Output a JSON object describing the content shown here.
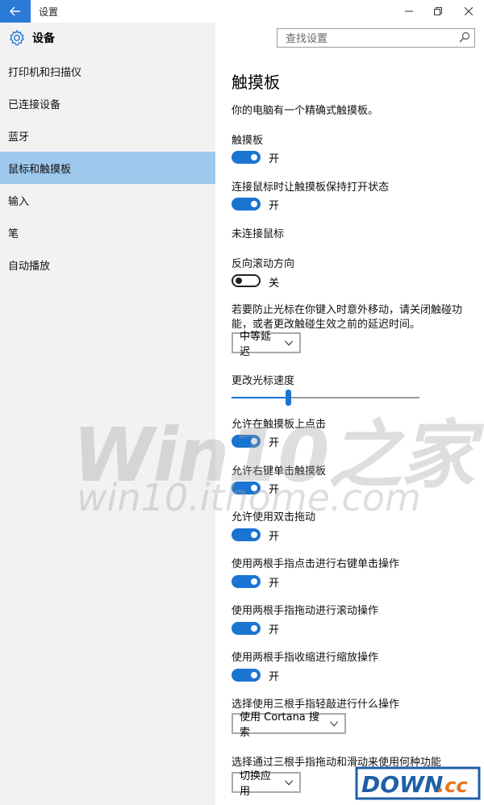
{
  "window": {
    "title": "设置",
    "back_icon": "back-arrow-icon"
  },
  "sidebar": {
    "header": "设备",
    "items": [
      {
        "label": "打印机和扫描仪",
        "selected": false
      },
      {
        "label": "已连接设备",
        "selected": false
      },
      {
        "label": "蓝牙",
        "selected": false
      },
      {
        "label": "鼠标和触摸板",
        "selected": true
      },
      {
        "label": "输入",
        "selected": false
      },
      {
        "label": "笔",
        "selected": false
      },
      {
        "label": "自动播放",
        "selected": false
      }
    ]
  },
  "search": {
    "placeholder": "查找设置"
  },
  "main": {
    "title": "触摸板",
    "description": "你的电脑有一个精确式触摸板。",
    "touchpad": {
      "label": "触摸板",
      "state": "开"
    },
    "keep_on_with_mouse": {
      "label": "连接鼠标时让触摸板保持打开状态",
      "state": "开"
    },
    "mouse_status": "未连接鼠标",
    "reverse_scroll": {
      "label": "反向滚动方向",
      "state": "关"
    },
    "delay_description_line1": "若要防止光标在你键入时意外移动，请关闭触碰功",
    "delay_description_line2": "能，或者更改触碰生效之前的延迟时间。",
    "delay_dropdown": "中等延迟",
    "cursor_speed": {
      "label": "更改光标速度",
      "value_fraction": 0.3
    },
    "tap_to_click": {
      "label": "允许在触摸板上点击",
      "state": "开"
    },
    "right_click": {
      "label": "允许右键单击触摸板",
      "state": "开"
    },
    "double_tap_drag": {
      "label": "允许使用双击拖动",
      "state": "开"
    },
    "two_finger_right_click": {
      "label": "使用两根手指点击进行右键单击操作",
      "state": "开"
    },
    "two_finger_scroll": {
      "label": "使用两根手指拖动进行滚动操作",
      "state": "开"
    },
    "two_finger_zoom": {
      "label": "使用两根手指收缩进行缩放操作",
      "state": "开"
    },
    "three_finger_tap": {
      "label": "选择使用三根手指轻敲进行什么操作",
      "value": "使用 Cortana 搜索"
    },
    "three_finger_drag": {
      "label": "选择通过三根手指拖动和滑动来使用何种功能",
      "value": "切换应用"
    }
  },
  "watermark": {
    "big": "Win10之家",
    "small": "win10.ithome.com"
  },
  "logo": {
    "text": "DOWN",
    "suffix": ".cc"
  },
  "colors": {
    "accent": "#1a74d2",
    "selected_nav": "#9ec8ec",
    "sidebar_bg": "#f2f2f2"
  }
}
